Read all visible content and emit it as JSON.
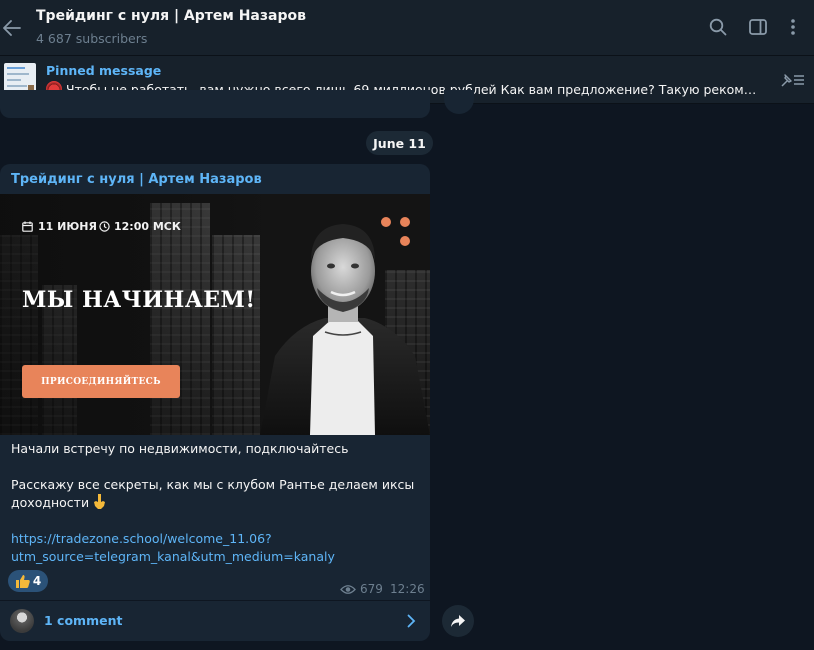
{
  "header": {
    "title": "Трейдинг с нуля | Артем Назаров",
    "subtitle": "4 687 subscribers"
  },
  "pinned": {
    "label": "Pinned message",
    "text": "Чтобы не работать, вам нужно всего лишь 69 миллионов рублей   Как вам предложение? Такую рекомендa..."
  },
  "date_separator": "June 11",
  "post": {
    "channel_name": "Трейдинг с нуля | Артем Назаров",
    "banner": {
      "date": "11 ИЮНЯ",
      "time": "12:00 МСК",
      "headline": "МЫ НАЧИНАЕМ!",
      "button": "ПРИСОЕДИНЯЙТЕСЬ"
    },
    "line1": "Начали встречу по недвижимости, подключайтесь",
    "line2": "Расскажу все секреты, как мы с клубом Рантье делаем иксы",
    "line3": "доходности",
    "link_line1": "https://tradezone.school/welcome_11.06?",
    "link_line2": "utm_source=telegram_kanal&utm_medium=kanaly",
    "reaction_count": "4",
    "views": "679",
    "time": "12:26",
    "comments": "1 comment"
  },
  "icons": {
    "back": "back-arrow-icon",
    "search": "search-icon",
    "sidebar": "sidebar-toggle-icon",
    "more": "more-vertical-icon",
    "pin_list": "pin-list-icon",
    "views": "eye-icon",
    "share": "share-arrow-icon",
    "chevron": "chevron-right-icon"
  },
  "colors": {
    "background": "#0e1621",
    "panel": "#17212b",
    "bubble": "#182533",
    "accent": "#5eb5f7",
    "banner_orange": "#e8845a"
  }
}
